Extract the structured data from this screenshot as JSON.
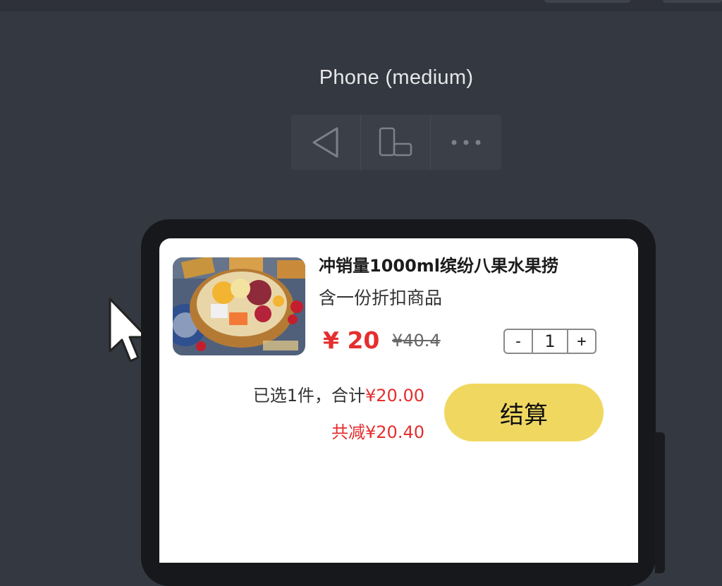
{
  "device": {
    "label": "Phone (medium)"
  },
  "toolbar": {
    "buttons": [
      {
        "icon": "back-triangle-icon"
      },
      {
        "icon": "rotate-device-icon"
      },
      {
        "icon": "more-dots-icon"
      }
    ]
  },
  "product": {
    "title": "冲销量1000ml缤纷八果水果捞",
    "subtitle": "含一份折扣商品",
    "price": "¥ 20",
    "original_price": "¥40.4",
    "image_icon": "fruit-bowl-image"
  },
  "stepper": {
    "minus": "-",
    "quantity": "1",
    "plus": "+"
  },
  "summary": {
    "selected_text": "已选1件，合计",
    "total": "¥20.00",
    "saved_text": "共减¥20.40"
  },
  "checkout": {
    "label": "结算"
  },
  "colors": {
    "accent_red": "#e52e2e",
    "checkout_yellow": "#f0d860",
    "background": "#343840"
  }
}
